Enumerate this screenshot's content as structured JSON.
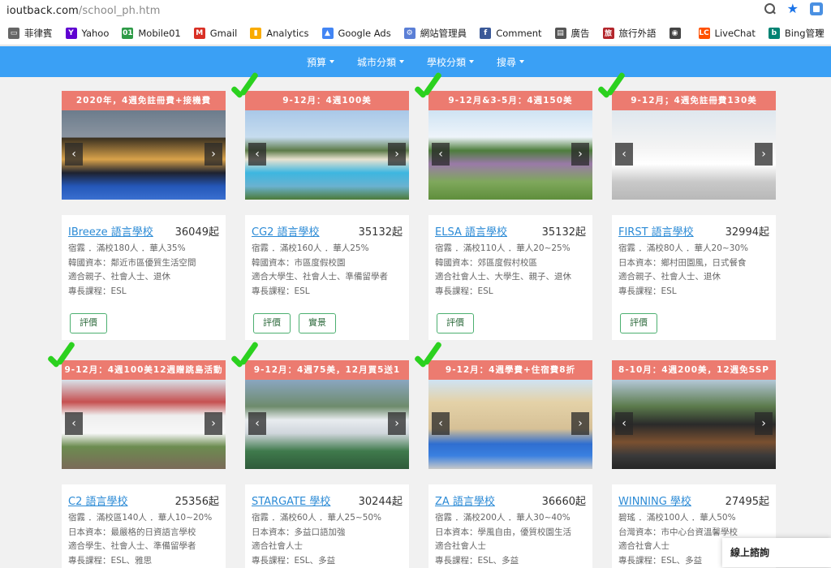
{
  "browser": {
    "url_host": "ioutback.com",
    "url_path": "/school_ph.htm"
  },
  "bookmarks": {
    "items": [
      {
        "label": "菲律賓",
        "icon": "folder-icon",
        "color": "#666666"
      },
      {
        "label": "Yahoo",
        "icon": "yahoo-icon",
        "color": "#5f01d1"
      },
      {
        "label": "Mobile01",
        "icon": "mobile01-icon",
        "color": "#2e9b47"
      },
      {
        "label": "Gmail",
        "icon": "gmail-icon",
        "color": "#d93025"
      },
      {
        "label": "Analytics",
        "icon": "analytics-icon",
        "color": "#f9ab00"
      },
      {
        "label": "Google Ads",
        "icon": "google-ads-icon",
        "color": "#4285f4"
      },
      {
        "label": "網站管理員",
        "icon": "webmaster-icon",
        "color": "#5b7fd6"
      },
      {
        "label": "Comment",
        "icon": "facebook-icon",
        "color": "#3b5998"
      },
      {
        "label": "廣告",
        "icon": "ad-icon",
        "color": "#555555"
      },
      {
        "label": "旅行外語",
        "icon": "travel-icon",
        "color": "#b3262c"
      },
      {
        "label": "",
        "icon": "globe-icon",
        "color": "#444444"
      },
      {
        "label": "LiveChat",
        "icon": "livechat-icon",
        "color": "#ff5100"
      },
      {
        "label": "Bing管理",
        "icon": "bing-icon",
        "color": "#008373"
      }
    ],
    "more": "»"
  },
  "nav": {
    "items": [
      "預算",
      "城市分類",
      "學校分類",
      "搜尋"
    ]
  },
  "schools": [
    {
      "banner": "2020年，4週免註冊費+接機費",
      "name": "IBreeze 語言學校",
      "price": "36049起",
      "lines": [
        "宿霧 ．滿校180人 ．華人35%",
        "韓國資本：鄰近市區優質生活空間",
        "適合親子、社會人士、退休",
        "專長課程：ESL"
      ],
      "buttons": [
        "評價"
      ],
      "checked": false
    },
    {
      "banner": "9-12月：4週100美",
      "name": "CG2 語言學校",
      "price": "35132起",
      "lines": [
        "宿霧 ．滿校160人 ．華人25%",
        "韓國資本：市區度假校園",
        "適合大學生、社會人士、準備留學者",
        "專長課程：ESL"
      ],
      "buttons": [
        "評價",
        "實景"
      ],
      "checked": true
    },
    {
      "banner": "9-12月&3-5月：4週150美",
      "name": "ELSA 語言學校",
      "price": "35132起",
      "lines": [
        "宿霧 ．滿校110人 ．華人20~25%",
        "韓國資本：郊區度假村校區",
        "適合社會人士、大學生、親子、退休",
        "專長課程：ESL"
      ],
      "buttons": [
        "評價"
      ],
      "checked": true
    },
    {
      "banner": "9-12月；4週免註冊費130美",
      "name": "FIRST 語言學校",
      "price": "32994起",
      "lines": [
        "宿霧 ．滿校80人 ．華人20~30%",
        "日本資本：鄉村田園風，日式餐食",
        "適合親子、社會人士、退休",
        "專長課程：ESL"
      ],
      "buttons": [
        "評價"
      ],
      "checked": true
    },
    {
      "banner": "9-12月：4週100美12週贈跳島活動",
      "name": "C2 語言學校",
      "price": "25356起",
      "lines": [
        "宿霧 ．滿校區140人 ．華人10~20%",
        "日本資本：最嚴格的日資語言學校",
        "適合學生、社會人士、準備留學者",
        "專長課程：ESL、雅思"
      ],
      "buttons": [],
      "checked": true
    },
    {
      "banner": "9-12月：4週75美，12月買5送1",
      "name": "STARGATE 學校",
      "price": "30244起",
      "lines": [
        "宿霧 ．滿校60人 ．華人25~50%",
        "日本資本：多益口語加強",
        "適合社會人士",
        "專長課程：ESL、多益"
      ],
      "buttons": [],
      "checked": true
    },
    {
      "banner": "9-12月：4週學費+住宿費8折",
      "name": "ZA 語言學校",
      "price": "36660起",
      "lines": [
        "宿霧 ．滿校200人 ．華人30~40%",
        "日本資本：學風自由，優質校園生活",
        "適合社會人士",
        "專長課程：ESL、多益"
      ],
      "buttons": [],
      "checked": true
    },
    {
      "banner": "8-10月：4週200美，12週免SSP",
      "name": "WINNING 學校",
      "price": "27495起",
      "lines": [
        "碧瑤 ．滿校100人 ．華人50%",
        "台灣資本：市中心台資溫馨學校",
        "適合社會人士",
        "專長課程：ESL、多益"
      ],
      "buttons": [],
      "checked": false
    }
  ],
  "chat": {
    "label": "線上諮詢"
  }
}
